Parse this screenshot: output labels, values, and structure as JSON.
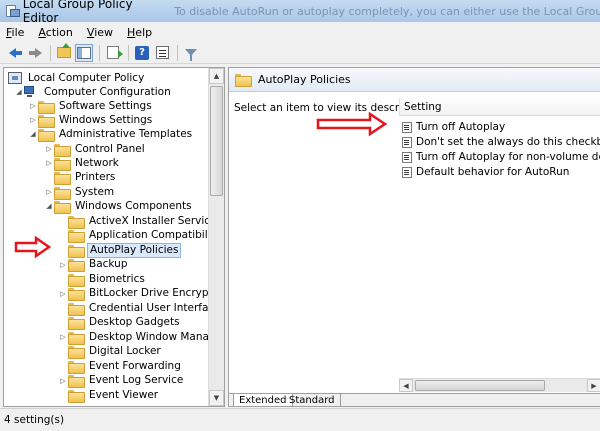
{
  "window": {
    "title": "Local Group Policy Editor",
    "background_text": "To disable AutoRun or autoplay completely, you can either use the Local Group Policy Editor"
  },
  "menu": [
    {
      "label": "File",
      "accel": "F",
      "rest": "ile"
    },
    {
      "label": "Action",
      "accel": "A",
      "rest": "ction"
    },
    {
      "label": "View",
      "accel": "V",
      "rest": "iew"
    },
    {
      "label": "Help",
      "accel": "H",
      "rest": "elp"
    }
  ],
  "toolbar": {
    "icons": [
      "back-arrow-icon",
      "forward-arrow-icon",
      "up-folder-icon",
      "show-hide-tree-icon",
      "export-list-icon",
      "help-icon",
      "properties-icon",
      "filter-icon"
    ]
  },
  "tree": {
    "root": "Local Computer Policy",
    "computer_configuration": "Computer Configuration",
    "software_settings": "Software Settings",
    "windows_settings": "Windows Settings",
    "administrative_templates": "Administrative Templates",
    "control_panel": "Control Panel",
    "network": "Network",
    "printers": "Printers",
    "system": "System",
    "windows_components": "Windows Components",
    "components": [
      {
        "label": "ActiveX Installer Service",
        "expander": ""
      },
      {
        "label": "Application Compatibility",
        "expander": ""
      },
      {
        "label": "AutoPlay Policies",
        "expander": "",
        "selected": true
      },
      {
        "label": "Backup",
        "expander": "▷"
      },
      {
        "label": "Biometrics",
        "expander": ""
      },
      {
        "label": "BitLocker Drive Encryption",
        "expander": "▷"
      },
      {
        "label": "Credential User Interface",
        "expander": ""
      },
      {
        "label": "Desktop Gadgets",
        "expander": ""
      },
      {
        "label": "Desktop Window Manager",
        "expander": "▷"
      },
      {
        "label": "Digital Locker",
        "expander": ""
      },
      {
        "label": "Event Forwarding",
        "expander": ""
      },
      {
        "label": "Event Log Service",
        "expander": "▷"
      },
      {
        "label": "Event Viewer",
        "expander": ""
      }
    ]
  },
  "right_pane": {
    "header_title": "AutoPlay Policies",
    "description": "Select an item to view its description.",
    "column_header": "Setting",
    "settings": [
      "Turn off Autoplay",
      "Don't set the always do this checkbox",
      "Turn off Autoplay for non-volume devices",
      "Default behavior for AutoRun"
    ],
    "tabs": [
      "Extended",
      "Standard"
    ],
    "active_tab": "Extended"
  },
  "status": {
    "text": "4 setting(s)"
  },
  "colors": {
    "annotation_arrow": "#e8141c",
    "selection": "#d9e8fb",
    "titlebar": "#b9d1ea"
  }
}
